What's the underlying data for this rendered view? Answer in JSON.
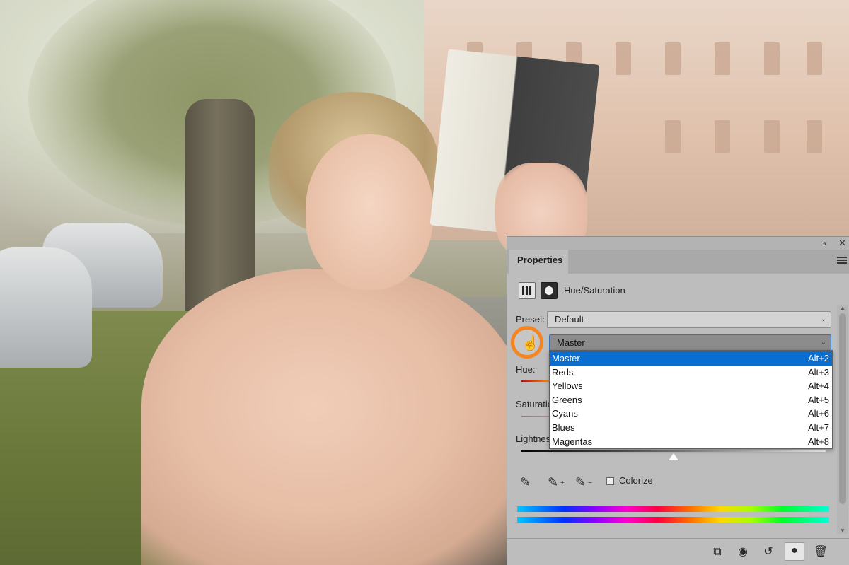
{
  "panel": {
    "tab_label": "Properties",
    "adjustment_title": "Hue/Saturation",
    "preset_label": "Preset:",
    "preset_value": "Default",
    "channel_value": "Master",
    "channel_options": [
      {
        "label": "Master",
        "shortcut": "Alt+2",
        "selected": true
      },
      {
        "label": "Reds",
        "shortcut": "Alt+3"
      },
      {
        "label": "Yellows",
        "shortcut": "Alt+4"
      },
      {
        "label": "Greens",
        "shortcut": "Alt+5"
      },
      {
        "label": "Cyans",
        "shortcut": "Alt+6"
      },
      {
        "label": "Blues",
        "shortcut": "Alt+7"
      },
      {
        "label": "Magentas",
        "shortcut": "Alt+8"
      }
    ],
    "hue_label": "Hue:",
    "saturation_label": "Saturation",
    "lightness_label": "Lightnes",
    "colorize_label": "Colorize",
    "colorize_checked": false,
    "top_glyphs": {
      "collapse": "‹‹",
      "close": "✕"
    },
    "bottom_icons": [
      "clip-to-layer-icon",
      "view-previous-state-icon",
      "reset-icon",
      "visibility-icon",
      "trash-icon"
    ]
  },
  "colors": {
    "highlight_ring": "#f58520",
    "selection_blue": "#0a6ed1",
    "panel_bg": "#bdbdbd"
  }
}
